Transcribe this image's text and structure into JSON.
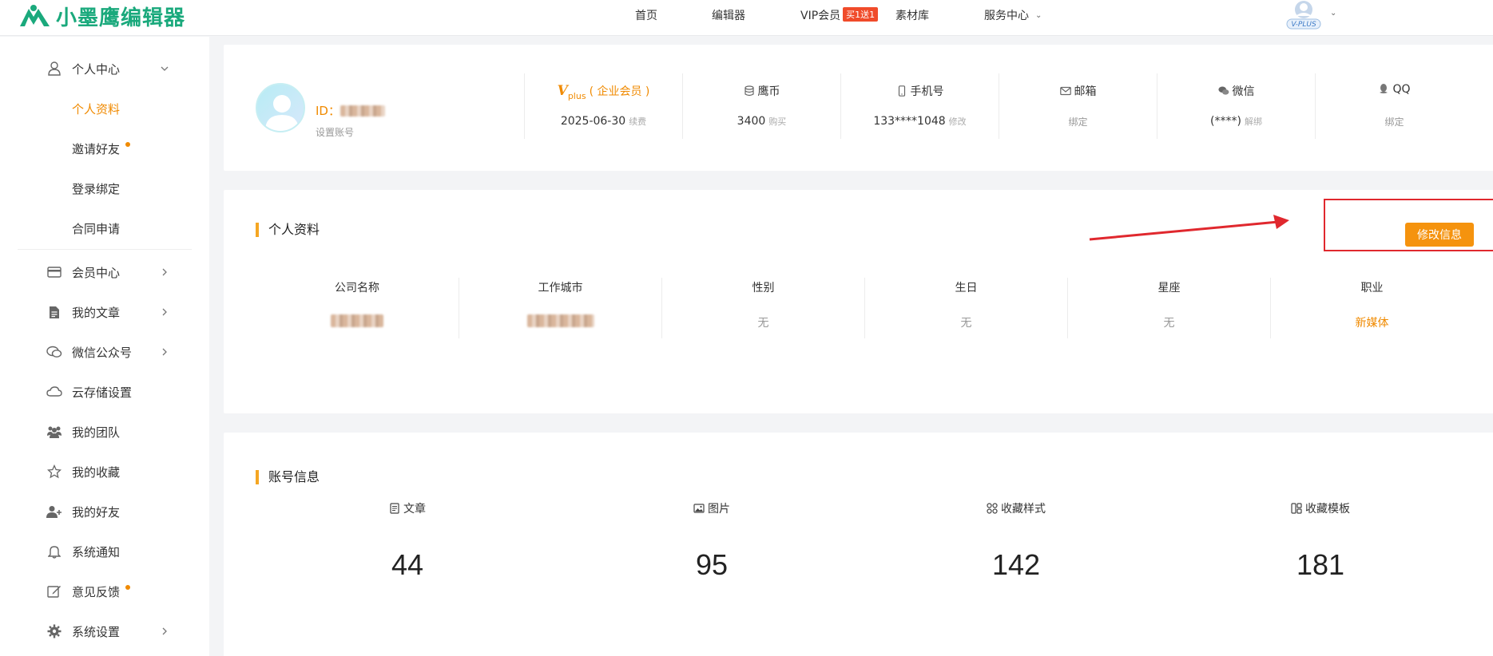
{
  "brand": {
    "name": "小墨鹰编辑器",
    "color": "#1aa97c"
  },
  "nav": {
    "home": "首页",
    "editor": "编辑器",
    "vip": "VIP会员",
    "vip_badge": "买1送1",
    "materials": "素材库",
    "service": "服务中心",
    "avatar_badge": "V-PLUS"
  },
  "sidebar": {
    "personal_center": "个人中心",
    "sub": {
      "profile": "个人资料",
      "invite": "邀请好友",
      "login_bind": "登录绑定",
      "contract": "合同申请"
    },
    "items": [
      {
        "label": "会员中心",
        "icon": "card-icon"
      },
      {
        "label": "我的文章",
        "icon": "document-icon"
      },
      {
        "label": "微信公众号",
        "icon": "chat-icon"
      },
      {
        "label": "云存储设置",
        "icon": "cloud-icon"
      },
      {
        "label": "我的团队",
        "icon": "team-icon"
      },
      {
        "label": "我的收藏",
        "icon": "star-icon"
      },
      {
        "label": "我的好友",
        "icon": "add-friend-icon"
      },
      {
        "label": "系统通知",
        "icon": "bell-icon"
      },
      {
        "label": "意见反馈",
        "icon": "edit-icon"
      },
      {
        "label": "系统设置",
        "icon": "gear-icon"
      }
    ]
  },
  "account": {
    "id_label": "ID：",
    "set_account": "设置账号",
    "membership": {
      "v": "V",
      "plus": "plus",
      "label": "( 企业会员 )",
      "date": "2025-06-30",
      "action": "续费"
    },
    "coins": {
      "label": "鹰币",
      "value": "3400",
      "action": "购买"
    },
    "phone": {
      "label": "手机号",
      "value": "133****1048",
      "action": "修改"
    },
    "email": {
      "label": "邮箱",
      "action": "绑定"
    },
    "wechat": {
      "label": "微信",
      "value": "(****)",
      "action": "解绑"
    },
    "qq": {
      "label": "QQ",
      "action": "绑定"
    }
  },
  "profile": {
    "title": "个人资料",
    "edit_button": "修改信息",
    "fields": [
      {
        "label": "公司名称",
        "value": ""
      },
      {
        "label": "工作城市",
        "value": ""
      },
      {
        "label": "性别",
        "value": "无"
      },
      {
        "label": "生日",
        "value": "无"
      },
      {
        "label": "星座",
        "value": "无"
      },
      {
        "label": "职业",
        "value": "新媒体"
      }
    ]
  },
  "account_info": {
    "title": "账号信息",
    "stats": [
      {
        "label": "文章",
        "value": "44",
        "icon": "article-icon"
      },
      {
        "label": "图片",
        "value": "95",
        "icon": "image-icon"
      },
      {
        "label": "收藏样式",
        "value": "142",
        "icon": "style-icon"
      },
      {
        "label": "收藏模板",
        "value": "181",
        "icon": "template-icon"
      }
    ]
  },
  "colors": {
    "accent": "#f08a00",
    "button": "#f5930e",
    "annotation": "#e0282e"
  }
}
